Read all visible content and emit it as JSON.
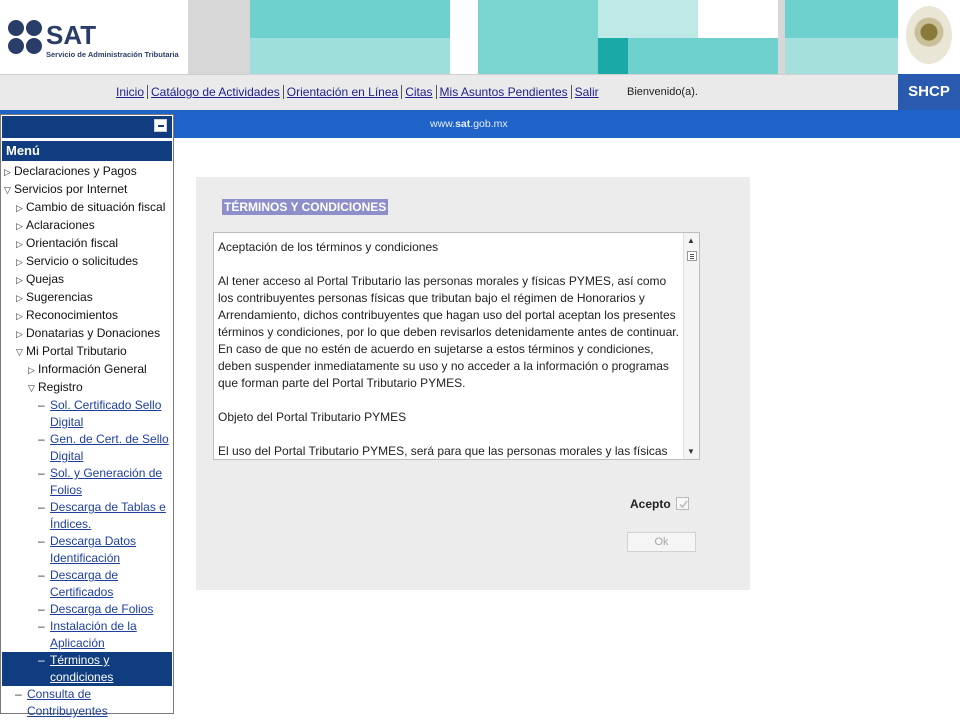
{
  "header": {
    "logo_text": "SAT",
    "logo_subtitle": "Servicio de Administración Tributaria",
    "shcp_label": "SHCP",
    "welcome_text": "Bienvenido(a)."
  },
  "nav": {
    "links": [
      "Inicio",
      "Catálogo de Actividades",
      "Orientación en Línea",
      "Citas",
      "Mis Asuntos Pendientes",
      "Salir"
    ]
  },
  "bluebar": {
    "url_pre": "www.",
    "url_bold": "sat",
    "url_post": ".gob.mx"
  },
  "sidebar": {
    "title": "Menú",
    "items": {
      "declaraciones": "Declaraciones y Pagos",
      "servicios": "Servicios por Internet",
      "cambio": "Cambio de situación fiscal",
      "aclaraciones": "Aclaraciones",
      "orientacion": "Orientación fiscal",
      "servicio_sol": "Servicio o solicitudes",
      "quejas": "Quejas",
      "sugerencias": "Sugerencias",
      "reconocimientos": "Reconocimientos",
      "donatarias": "Donatarias y Donaciones",
      "mi_portal": "Mi Portal Tributario",
      "info_general": "Información General",
      "registro": "Registro",
      "sol_cert_1": "Sol. Certificado Sello",
      "sol_cert_2": "Digital",
      "gen_cert_1": "Gen. de Cert. de Sello",
      "gen_cert_2": "Digital",
      "sol_gen_1": "Sol. y Generación de",
      "sol_gen_2": "Folios",
      "desc_tablas_1": "Descarga de Tablas e",
      "desc_tablas_2": "Índices.",
      "desc_datos_1": "Descarga Datos",
      "desc_datos_2": "Identificación",
      "desc_cert_1": "Descarga de",
      "desc_cert_2": "Certificados",
      "desc_folios": "Descarga de Folios",
      "instalacion_1": "Instalación de la",
      "instalacion_2": "Aplicación",
      "terminos_1": "Términos y",
      "terminos_2": "condiciones",
      "consulta_1": "Consulta de",
      "consulta_2": "Contribuyentes"
    }
  },
  "main": {
    "title": "TÉRMINOS Y CONDICIONES",
    "terms": {
      "heading": "Aceptación de los términos y condiciones",
      "para1": [
        "Al tener acceso al Portal Tributario las personas morales y físicas PYMES, así como",
        "los contribuyentes personas físicas que tributan bajo el régimen de Honorarios y",
        "Arrendamiento, dichos contribuyentes que hagan uso del portal aceptan los presentes",
        "términos y condiciones, por lo que deben revisarlos detenidamente antes de continuar.",
        "En caso de que no estén de acuerdo en sujetarse a estos términos y condiciones,",
        "deben suspender inmediatamente su uso y no acceder a la información o programas",
        "que forman parte del Portal Tributario PYMES."
      ],
      "heading2": "Objeto del Portal Tributario PYMES",
      "para2": [
        "El uso del Portal Tributario PYMES, será para que las personas morales y las físicas"
      ]
    },
    "acepto_label": "Acepto",
    "acepto_checked": true,
    "ok_label": "Ok"
  },
  "colors": {
    "brand_navy": "#0f3d80",
    "blue_bar": "#1f63c8",
    "shcp_blue": "#2a59b0",
    "title_highlight": "#8e8ecb",
    "link": "#1f3f9f"
  }
}
